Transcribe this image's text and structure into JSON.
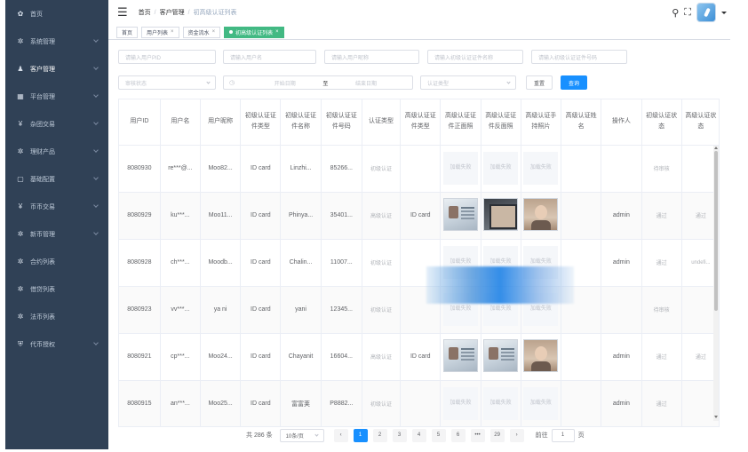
{
  "sidebar": {
    "items": [
      {
        "icon": "dashboard-icon",
        "glyph": "✿",
        "label": "首页",
        "chevron": false,
        "active": false
      },
      {
        "icon": "gear-icon",
        "glyph": "✲",
        "label": "系统管理",
        "chevron": true,
        "active": false
      },
      {
        "icon": "user-icon",
        "glyph": "♟",
        "label": "客户管理",
        "chevron": true,
        "active": true
      },
      {
        "icon": "grid-icon",
        "glyph": "▦",
        "label": "平台管理",
        "chevron": true,
        "active": false
      },
      {
        "icon": "yen-icon",
        "glyph": "¥",
        "label": "杂团交易",
        "chevron": true,
        "active": false
      },
      {
        "icon": "settings-icon",
        "glyph": "✲",
        "label": "理财产品",
        "chevron": true,
        "active": false
      },
      {
        "icon": "square-icon",
        "glyph": "▢",
        "label": "基础配置",
        "chevron": true,
        "active": false
      },
      {
        "icon": "yen-icon",
        "glyph": "¥",
        "label": "币币交易",
        "chevron": true,
        "active": false
      },
      {
        "icon": "settings-icon",
        "glyph": "✲",
        "label": "新币管理",
        "chevron": true,
        "active": false
      },
      {
        "icon": "settings-icon",
        "glyph": "✲",
        "label": "合约列表",
        "chevron": false,
        "active": false
      },
      {
        "icon": "settings-icon",
        "glyph": "✲",
        "label": "借贷列表",
        "chevron": false,
        "active": false
      },
      {
        "icon": "settings-icon",
        "glyph": "✲",
        "label": "法币列表",
        "chevron": false,
        "active": false
      },
      {
        "icon": "shield-icon",
        "glyph": "⛨",
        "label": "代币授权",
        "chevron": true,
        "active": false
      }
    ]
  },
  "header": {
    "breadcrumb": [
      "首页",
      "客户管理",
      "初高级认证列表"
    ]
  },
  "tags": [
    {
      "label": "首页",
      "closable": false,
      "active": false
    },
    {
      "label": "用户列表",
      "closable": true,
      "active": false
    },
    {
      "label": "资金流水",
      "closable": true,
      "active": false
    },
    {
      "label": "初高级认证列表",
      "closable": true,
      "active": true
    }
  ],
  "filters": {
    "pid_placeholder": "请输入用户PID",
    "username_placeholder": "请输入用户名",
    "nickname_placeholder": "请输入用户昵称",
    "cert_name_placeholder": "请输入初级认证证件名称",
    "cert_number_placeholder": "请输入初级认证证件号码",
    "audit_status_placeholder": "审核状态",
    "start_date_placeholder": "开始日期",
    "date_separator": "至",
    "end_date_placeholder": "结束日期",
    "cert_type_placeholder": "认证类型",
    "reset_label": "重置",
    "search_label": "查询"
  },
  "table": {
    "columns": [
      "用户ID",
      "用户名",
      "用户昵称",
      "初级认证证件类型",
      "初级认证证件名称",
      "初级认证证件号码",
      "认证类型",
      "高级认证证件类型",
      "高级认证证件正面照",
      "高级认证证件反面照",
      "高级认证手持照片",
      "高级认证姓名",
      "操作人",
      "初级认证状态",
      "高级认证状态"
    ],
    "rows": [
      {
        "id": "8080930",
        "username": "re***@...",
        "nickname": "Moo82...",
        "cert_type": "ID card",
        "cert_name": "Linzhi...",
        "cert_number": "85266...",
        "auth_type": "初级认证",
        "adv_cert_type": "",
        "photos": [
          "fail",
          "fail",
          "fail"
        ],
        "photo_fail_text": "加载失败",
        "adv_name": "",
        "operator": "",
        "basic_status": "待审核",
        "adv_status": ""
      },
      {
        "id": "8080929",
        "username": "ku***...",
        "nickname": "Moo11...",
        "cert_type": "ID card",
        "cert_name": "Phinya...",
        "cert_number": "35401...",
        "auth_type": "高级认证",
        "adv_cert_type": "ID card",
        "photos": [
          "card",
          "dark",
          "person"
        ],
        "photo_fail_text": "加载失败",
        "adv_name": "",
        "operator": "admin",
        "basic_status": "通过",
        "adv_status": "通过"
      },
      {
        "id": "8080928",
        "username": "ch***...",
        "nickname": "Moodb...",
        "cert_type": "ID card",
        "cert_name": "Chalin...",
        "cert_number": "11007...",
        "auth_type": "初级认证",
        "adv_cert_type": "",
        "photos": [
          "fail",
          "fail",
          "fail"
        ],
        "photo_fail_text": "加载失败",
        "adv_name": "",
        "operator": "admin",
        "basic_status": "通过",
        "adv_status": "undefi..."
      },
      {
        "id": "8080923",
        "username": "vv***...",
        "nickname": "ya ni",
        "cert_type": "ID card",
        "cert_name": "yani",
        "cert_number": "12345...",
        "auth_type": "初级认证",
        "adv_cert_type": "",
        "photos": [
          "fail",
          "fail",
          "fail"
        ],
        "photo_fail_text": "加载失败",
        "adv_name": "",
        "operator": "",
        "basic_status": "待审核",
        "adv_status": ""
      },
      {
        "id": "8080921",
        "username": "cp***...",
        "nickname": "Moo24...",
        "cert_type": "ID card",
        "cert_name": "Chayanit",
        "cert_number": "16604...",
        "auth_type": "高级认证",
        "adv_cert_type": "ID card",
        "photos": [
          "card",
          "card",
          "person"
        ],
        "photo_fail_text": "加载失败",
        "adv_name": "",
        "operator": "admin",
        "basic_status": "通过",
        "adv_status": "通过"
      },
      {
        "id": "8080915",
        "username": "an***...",
        "nickname": "Moo25...",
        "cert_type": "ID card",
        "cert_name": "富富荚",
        "cert_number": "P8882...",
        "auth_type": "初级认证",
        "adv_cert_type": "",
        "photos": [
          "fail",
          "fail",
          "fail"
        ],
        "photo_fail_text": "加载失败",
        "adv_name": "",
        "operator": "admin",
        "basic_status": "通过",
        "adv_status": ""
      }
    ]
  },
  "pagination": {
    "total_text": "共 286 条",
    "page_size": "10条/页",
    "prev": "‹",
    "next": "›",
    "pages": [
      "1",
      "2",
      "3",
      "4",
      "5",
      "6",
      "•••",
      "29"
    ],
    "current_page": "1",
    "goto_label": "前往",
    "goto_value": "1",
    "page_suffix": "页"
  }
}
